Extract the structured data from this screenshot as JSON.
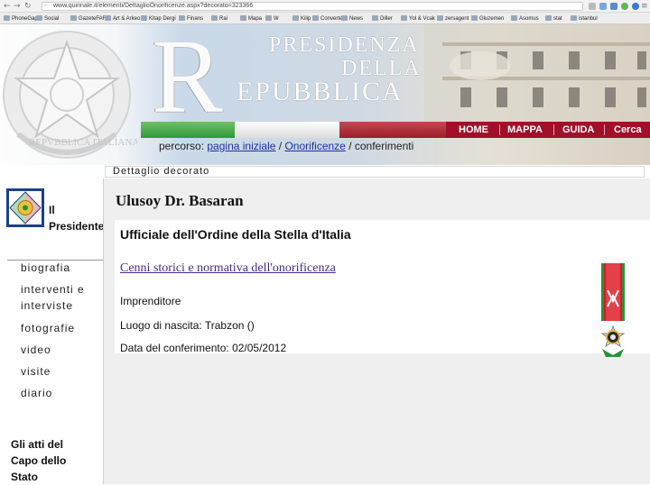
{
  "browser": {
    "url": "www.quirinale.it/elementi/DettaglioOnorificenze.aspx?decorato=323366",
    "bookmarks": [
      "PhoneGap",
      "Social",
      "GazeteFARC",
      "Art & Arkeo",
      "Kitap Dergi",
      "Finans",
      "Rai",
      "Mapa",
      "W",
      "Kilip",
      "Converter",
      "News",
      "Diller",
      "Yol & Vcak",
      "zersagent",
      "Gluzemen",
      "Asomus",
      "stat",
      "istanbul"
    ]
  },
  "header": {
    "logo_initial_r": "R",
    "logo_line1": "PRESIDENZA",
    "logo_line2": "DELLA",
    "logo_line3": "EPUBBLICA",
    "nav": [
      "HOME",
      "MAPPA",
      "GUIDA",
      "Cerca"
    ],
    "breadcrumb": {
      "prefix": "percorso:",
      "link1": "pagina iniziale",
      "sep1": "/",
      "link2": "Onorificenze",
      "sep2": "/",
      "current": "conferimenti"
    },
    "colors": {
      "nav_bg": "#a0102a",
      "flag_green": "#2f9a3a",
      "flag_red": "#9c1d2a"
    }
  },
  "section_label": "Dettaglio decorato",
  "sidebar": {
    "president_label_line1": "Il",
    "president_label_line2": "Presidente",
    "items": [
      "biografia",
      "interventi e",
      "interviste",
      "fotografie",
      "video",
      "visite",
      "diario"
    ],
    "atti_line1": "Gli atti del",
    "atti_line2": "Capo dello",
    "atti_line3": "Stato"
  },
  "main": {
    "recipient_name": "Ulusoy Dr. Basaran",
    "honor_title": "Ufficiale dell'Ordine della Stella d'Italia",
    "honor_link": "Cenni storici e normativa dell'onorificenza",
    "profession": "Imprenditore",
    "birthplace": "Luogo di nascita: Trabzon ()",
    "conferment_date": "Data del conferimento: 02/05/2012",
    "medal_icon": "stella-d-italia-medal-icon"
  }
}
